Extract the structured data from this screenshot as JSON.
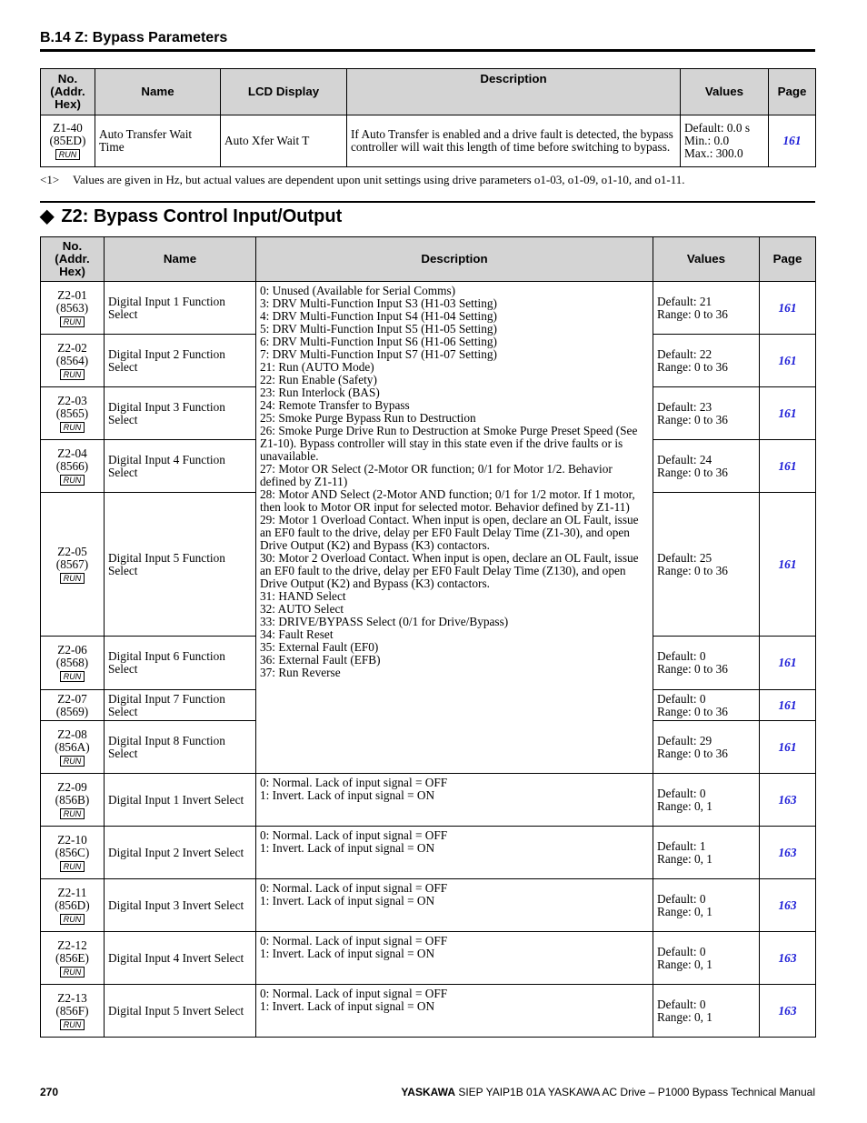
{
  "section": {
    "title": "B.14 Z: Bypass Parameters"
  },
  "table1": {
    "headers": {
      "no": "No. (Addr. Hex)",
      "name": "Name",
      "lcd": "LCD Display",
      "description": "Description",
      "values": "Values",
      "page": "Page"
    },
    "rows": [
      {
        "no": "Z1-40",
        "addr": "(85ED)",
        "badge": "RUN",
        "name": "Auto Transfer Wait Time",
        "lcd": "Auto Xfer Wait T",
        "description": "If Auto Transfer is enabled and a drive fault is detected, the bypass controller will wait this length of time before switching to bypass.",
        "values": [
          "Default: 0.0 s",
          "Min.: 0.0",
          "Max.: 300.0"
        ],
        "page": "161"
      }
    ]
  },
  "footnote": {
    "mark": "<1>",
    "text": "Values are given in Hz, but actual values are dependent upon unit settings using drive parameters o1-03, o1-09, o1-10, and o1-11."
  },
  "z2": {
    "title": "Z2: Bypass Control Input/Output",
    "headers": {
      "no": "No. (Addr. Hex)",
      "name": "Name",
      "description": "Description",
      "values": "Values",
      "page": "Page"
    },
    "shared_description": [
      "0: Unused (Available for Serial Comms)",
      "3: DRV Multi-Function Input S3 (H1-03 Setting)",
      "4: DRV Multi-Function Input S4 (H1-04 Setting)",
      "5: DRV Multi-Function Input S5 (H1-05 Setting)",
      "6: DRV Multi-Function Input S6 (H1-06 Setting)",
      "7: DRV Multi-Function Input S7 (H1-07 Setting)",
      "21: Run (AUTO Mode)",
      "22: Run Enable (Safety)",
      "23: Run Interlock (BAS)",
      "24: Remote Transfer to Bypass",
      "25: Smoke Purge Bypass Run to Destruction",
      "26: Smoke Purge Drive Run to Destruction at Smoke Purge Preset Speed (See Z1-10). Bypass controller will stay in this state even if the drive faults or is unavailable.",
      "27: Motor OR Select (2-Motor OR function; 0/1 for Motor 1/2. Behavior defined by Z1-11)",
      "28: Motor AND Select (2-Motor AND function; 0/1 for 1/2 motor. If 1 motor, then look to Motor OR input for selected motor. Behavior defined by Z1-11)",
      "29: Motor 1 Overload Contact. When input is open, declare an OL Fault, issue an EF0 fault to the drive, delay per EF0 Fault Delay Time (Z1-30), and open Drive Output (K2) and Bypass (K3) contactors.",
      "30: Motor 2 Overload Contact. When input is open, declare an OL Fault, issue an EF0 fault to the drive, delay per EF0 Fault Delay Time (Z130), and open Drive Output (K2) and Bypass (K3) contactors.",
      "31: HAND Select",
      "32: AUTO Select",
      "33: DRIVE/BYPASS Select (0/1 for Drive/Bypass)",
      "34: Fault Reset",
      "35: External Fault (EF0)",
      "36: External Fault (EFB)",
      "37: Run Reverse"
    ],
    "function_rows": [
      {
        "no": "Z2-01",
        "addr": "(8563)",
        "badge": "RUN",
        "name": "Digital Input 1 Function Select",
        "values": [
          "Default: 21",
          "Range: 0 to 36"
        ],
        "page": "161"
      },
      {
        "no": "Z2-02",
        "addr": "(8564)",
        "badge": "RUN",
        "name": "Digital Input 2 Function Select",
        "values": [
          "Default: 22",
          "Range: 0 to 36"
        ],
        "page": "161"
      },
      {
        "no": "Z2-03",
        "addr": "(8565)",
        "badge": "RUN",
        "name": "Digital Input 3 Function Select",
        "values": [
          "Default: 23",
          "Range: 0 to 36"
        ],
        "page": "161"
      },
      {
        "no": "Z2-04",
        "addr": "(8566)",
        "badge": "RUN",
        "name": "Digital Input 4 Function Select",
        "values": [
          "Default: 24",
          "Range: 0 to 36"
        ],
        "page": "161"
      },
      {
        "no": "Z2-05",
        "addr": "(8567)",
        "badge": "RUN",
        "name": "Digital Input 5 Function Select",
        "values": [
          "Default: 25",
          "Range: 0 to 36"
        ],
        "page": "161"
      },
      {
        "no": "Z2-06",
        "addr": "(8568)",
        "badge": "RUN",
        "name": "Digital Input 6 Function Select",
        "values": [
          "Default: 0",
          "Range: 0 to 36"
        ],
        "page": "161"
      },
      {
        "no": "Z2-07",
        "addr": "(8569)",
        "badge": "",
        "name": "Digital Input 7 Function Select",
        "values": [
          "Default: 0",
          "Range: 0 to 36"
        ],
        "page": "161"
      },
      {
        "no": "Z2-08",
        "addr": "(856A)",
        "badge": "RUN",
        "name": "Digital Input 8 Function Select",
        "values": [
          "Default: 29",
          "Range: 0 to 36"
        ],
        "page": "161"
      }
    ],
    "invert_rows": [
      {
        "no": "Z2-09",
        "addr": "(856B)",
        "badge": "RUN",
        "name": "Digital Input 1 Invert Select",
        "description": [
          "0: Normal. Lack of input signal = OFF",
          "1: Invert. Lack of input signal = ON"
        ],
        "values": [
          "Default: 0",
          "Range: 0, 1"
        ],
        "page": "163"
      },
      {
        "no": "Z2-10",
        "addr": "(856C)",
        "badge": "RUN",
        "name": "Digital Input 2 Invert Select",
        "description": [
          "0: Normal. Lack of input signal = OFF",
          "1: Invert. Lack of input signal = ON"
        ],
        "values": [
          "Default: 1",
          "Range: 0, 1"
        ],
        "page": "163"
      },
      {
        "no": "Z2-11",
        "addr": "(856D)",
        "badge": "RUN",
        "name": "Digital Input 3 Invert Select",
        "description": [
          "0: Normal. Lack of input signal = OFF",
          "1: Invert. Lack of input signal = ON"
        ],
        "values": [
          "Default: 0",
          "Range: 0, 1"
        ],
        "page": "163"
      },
      {
        "no": "Z2-12",
        "addr": "(856E)",
        "badge": "RUN",
        "name": "Digital Input 4 Invert Select",
        "description": [
          "0: Normal. Lack of input signal = OFF",
          "1: Invert. Lack of input signal = ON"
        ],
        "values": [
          "Default: 0",
          "Range: 0, 1"
        ],
        "page": "163"
      },
      {
        "no": "Z2-13",
        "addr": "(856F)",
        "badge": "RUN",
        "name": "Digital Input 5 Invert Select",
        "description": [
          "0: Normal. Lack of input signal = OFF",
          "1: Invert. Lack of input signal = ON"
        ],
        "values": [
          "Default: 0",
          "Range: 0, 1"
        ],
        "page": "163"
      }
    ]
  },
  "footer": {
    "page_number": "270",
    "brand": "YASKAWA",
    "doc_title": "SIEP YAIP1B 01A YASKAWA AC Drive – P1000 Bypass Technical Manual"
  },
  "colors": {
    "header_bg": "#d4d4d4",
    "page_link": "#1a1ad6"
  }
}
